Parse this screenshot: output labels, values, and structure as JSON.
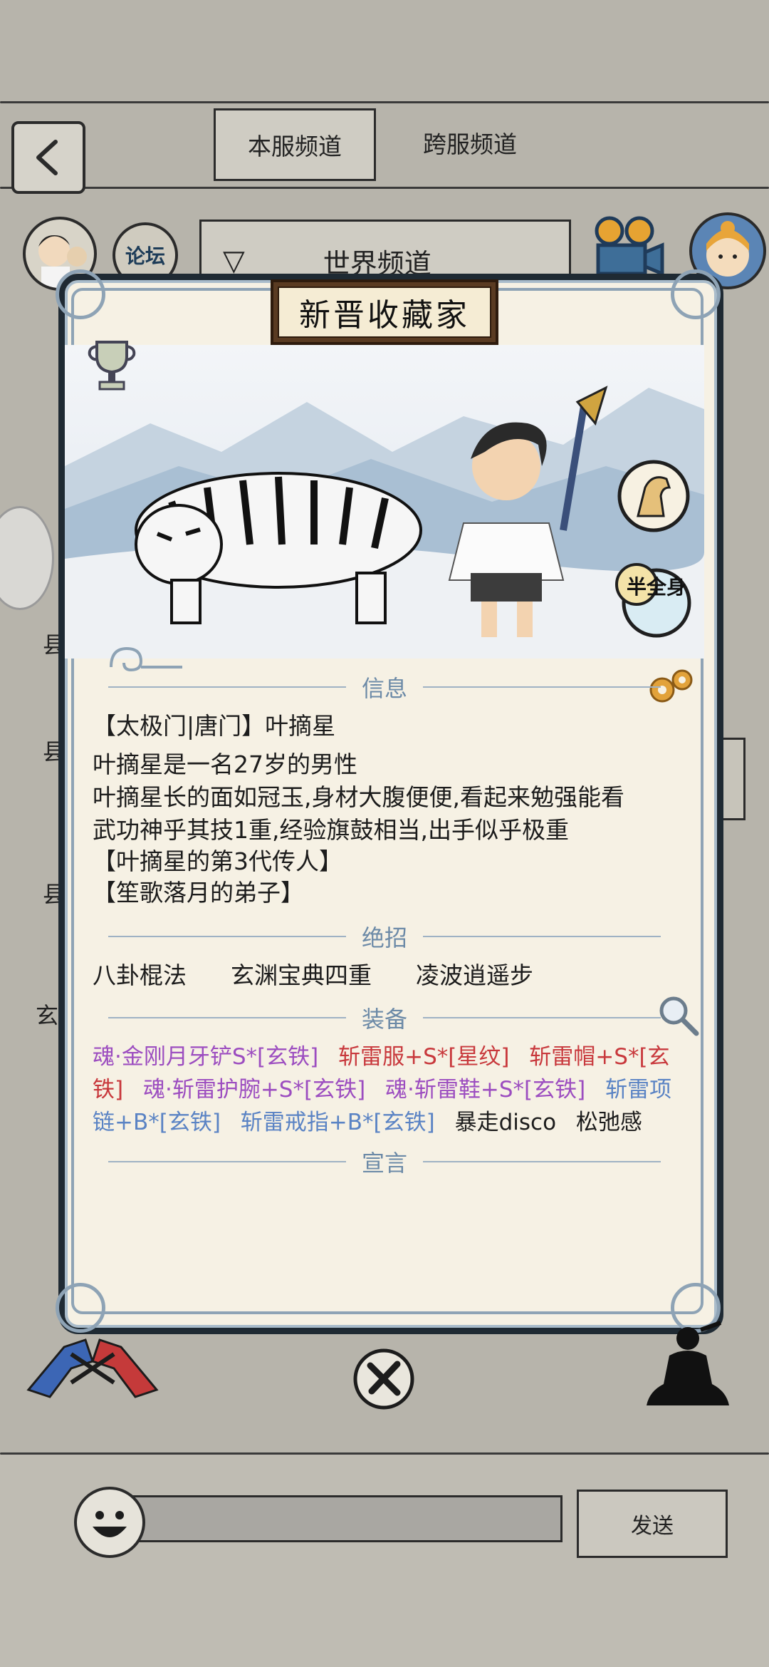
{
  "header": {
    "tabs": [
      {
        "label": "本服频道",
        "active": true
      },
      {
        "label": "跨服频道",
        "active": false
      }
    ]
  },
  "channel_bar": {
    "forum_label": "论坛",
    "channel_name": "世界频道"
  },
  "profile": {
    "title": "新晋收藏家",
    "sections": {
      "info": "信息",
      "skills": "绝招",
      "equipment": "装备",
      "manifesto": "宣言"
    },
    "info_lines": [
      "【太极门|唐门】叶摘星",
      "叶摘星是一名27岁的男性",
      "叶摘星长的面如冠玉,身材大腹便便,看起来勉强能看",
      "武功神乎其技1重,经验旗鼓相当,出手似乎极重",
      "【叶摘星的第3代传人】",
      "【笙歌落月的弟子】"
    ],
    "skills": [
      "八卦棍法",
      "玄渊宝典四重",
      "凌波逍遥步"
    ],
    "equipment": [
      {
        "text": "魂·金刚月牙铲S*[玄铁]",
        "color": "purple"
      },
      {
        "text": "斩雷服+S*[星纹]",
        "color": "red"
      },
      {
        "text": "斩雷帽+S*[玄铁]",
        "color": "red"
      },
      {
        "text": "魂·斩雷护腕+S*[玄铁]",
        "color": "purple"
      },
      {
        "text": "魂·斩雷鞋+S*[玄铁]",
        "color": "purple"
      },
      {
        "text": "斩雷项链+B*[玄铁]",
        "color": "blue"
      },
      {
        "text": "斩雷戒指+B*[玄铁]",
        "color": "blue"
      },
      {
        "text": "暴走disco",
        "color": "plain"
      },
      {
        "text": "松弛感",
        "color": "plain"
      }
    ],
    "badges": {
      "half_body_label": "半全身"
    }
  },
  "background_glyphs": [
    "县",
    "县",
    "县",
    "玄"
  ],
  "chat": {
    "input_value": "",
    "send_label": "发送"
  },
  "colors": {
    "background": "#b7b4ab",
    "card": "#f6f1e4",
    "section_title": "#6c8aa7",
    "equip_purple": "#9c4dc0",
    "equip_red": "#c8383c",
    "equip_blue": "#5a83c4"
  }
}
